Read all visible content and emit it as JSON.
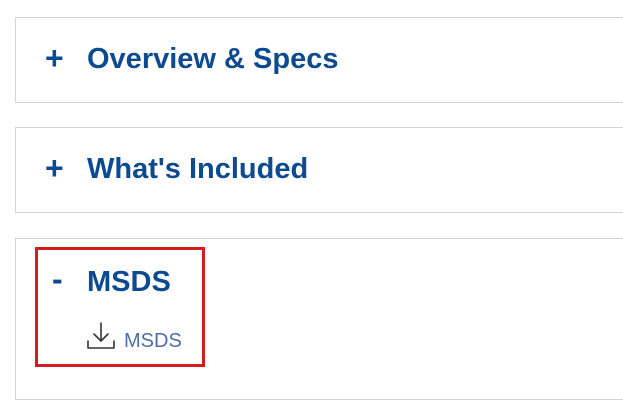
{
  "accordion": {
    "sections": [
      {
        "toggle": "+",
        "title": "Overview & Specs"
      },
      {
        "toggle": "+",
        "title": "What's Included"
      },
      {
        "toggle": "-",
        "title": "MSDS",
        "link_label": "MSDS"
      }
    ]
  },
  "colors": {
    "title": "#0d4a8f",
    "link": "#4d6fa9",
    "highlight": "#d31d1d",
    "border": "#d4d4d4"
  },
  "icons": {
    "download": "download-icon"
  }
}
